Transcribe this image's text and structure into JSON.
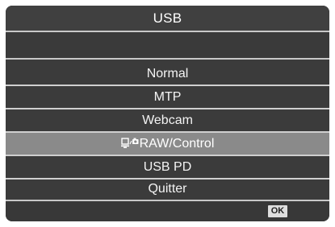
{
  "window": {
    "title": "USB"
  },
  "menu": {
    "items": [
      {
        "label": "Normal",
        "selected": false
      },
      {
        "label": "MTP",
        "selected": false
      },
      {
        "label": "Webcam",
        "selected": false
      },
      {
        "label": "RAW/Control",
        "selected": true,
        "icon": "pc-camera-icon"
      },
      {
        "label": "USB PD",
        "selected": false
      },
      {
        "label": "Quitter",
        "selected": false
      }
    ]
  },
  "footer": {
    "ok_label": "OK"
  },
  "colors": {
    "background": "#3c3c3c",
    "selected_row": "#8a8a8a",
    "separator": "#c8c8c8"
  }
}
